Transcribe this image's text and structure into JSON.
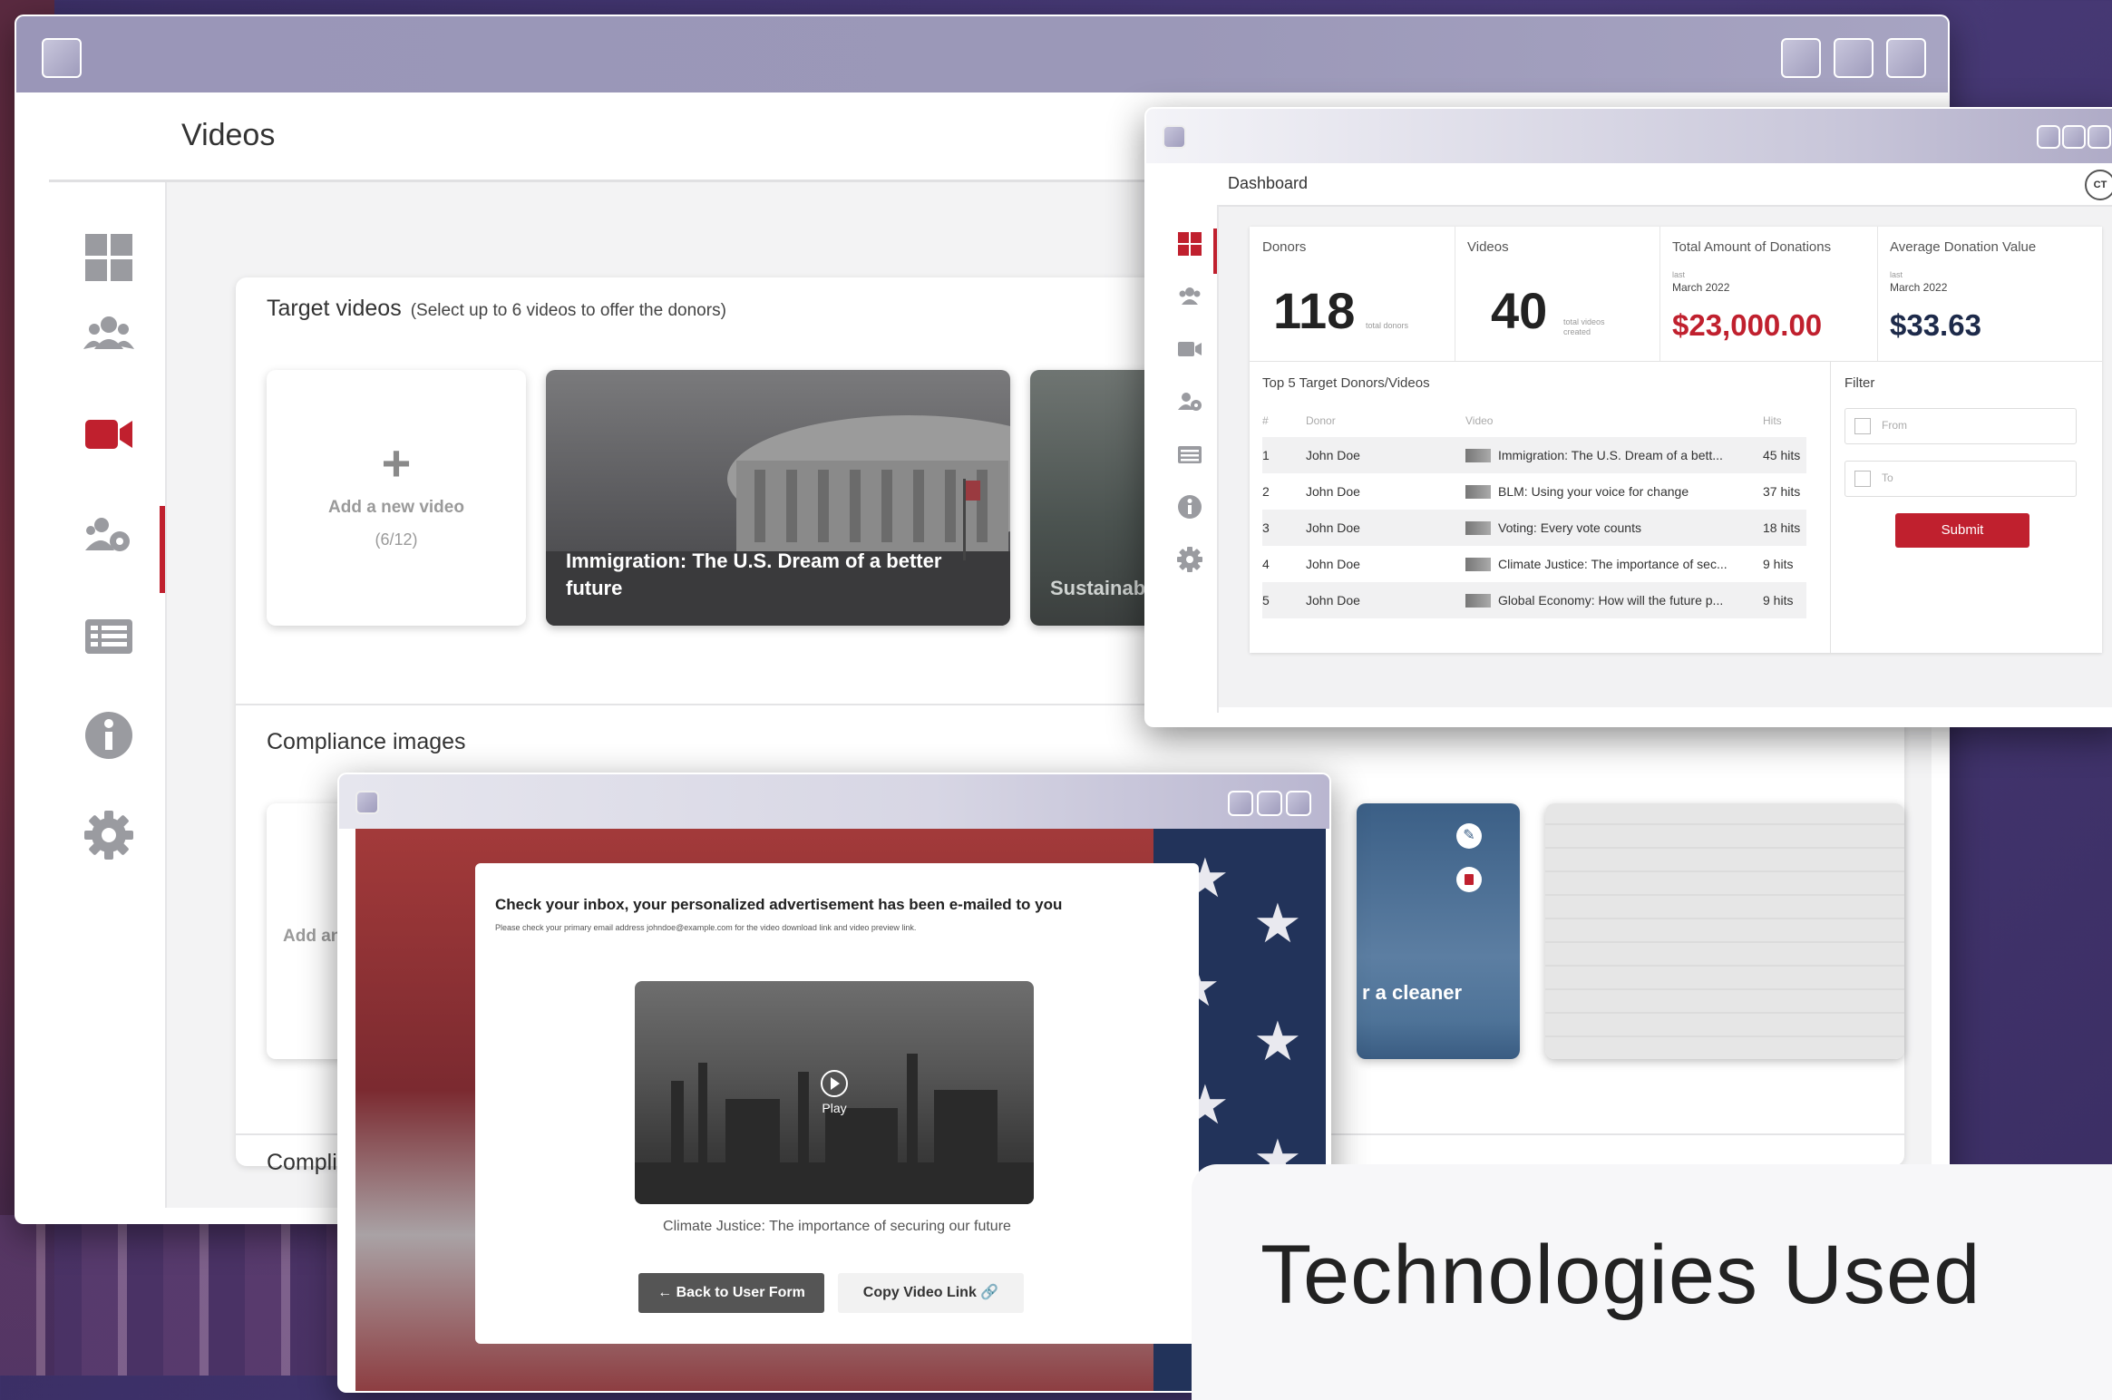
{
  "videos_page": {
    "title": "Videos",
    "target_videos": {
      "title": "Target videos",
      "subtitle": "(Select up to 6 videos to offer the donors)",
      "add_label": "Add a new video",
      "add_count": "(6/12)",
      "tiles": [
        {
          "caption": "Immigration: The U.S. Dream of a better future"
        },
        {
          "caption": "Sustainabil future"
        }
      ]
    },
    "compliance_images": {
      "title": "Compliance images",
      "add_label": "Add an i",
      "tile_caption": "r a cleaner"
    },
    "compliance_section_2": "Complian"
  },
  "dashboard": {
    "title": "Dashboard",
    "avatar": "CT",
    "stats": {
      "donors": {
        "label": "Donors",
        "value": "118",
        "note": "total donors"
      },
      "videos": {
        "label": "Videos",
        "value": "40",
        "note": "total videos created"
      },
      "total_donations": {
        "label": "Total Amount of Donations",
        "period_label": "last",
        "period": "March 2022",
        "value": "$23,000.00"
      },
      "avg_donation": {
        "label": "Average Donation Value",
        "period_label": "last",
        "period": "March 2022",
        "value": "$33.63"
      }
    },
    "top5": {
      "title": "Top 5 Target Donors/Videos",
      "headers": [
        "#",
        "Donor",
        "Video",
        "Hits"
      ],
      "rows": [
        {
          "n": "1",
          "donor": "John Doe",
          "video": "Immigration: The U.S. Dream of a bett...",
          "hits": "45 hits"
        },
        {
          "n": "2",
          "donor": "John Doe",
          "video": "BLM: Using your voice for change",
          "hits": "37 hits"
        },
        {
          "n": "3",
          "donor": "John Doe",
          "video": "Voting: Every vote counts",
          "hits": "18 hits"
        },
        {
          "n": "4",
          "donor": "John Doe",
          "video": "Climate Justice: The importance of sec...",
          "hits": "9 hits"
        },
        {
          "n": "5",
          "donor": "John Doe",
          "video": "Global Economy: How will the future p...",
          "hits": "9 hits"
        }
      ]
    },
    "filter": {
      "title": "Filter",
      "from_placeholder": "From",
      "to_placeholder": "To",
      "submit": "Submit"
    }
  },
  "email_modal": {
    "title": "Check your inbox, your personalized advertisement has been e-mailed to you",
    "subtitle": "Please check your primary email address johndoe@example.com for the video download link and video preview link.",
    "play": "Play",
    "video_caption": "Climate Justice: The importance of securing our future",
    "back_button": "Back to User Form",
    "copy_button": "Copy Video Link"
  },
  "technologies": {
    "title": "Technologies Used"
  },
  "colors": {
    "accent_red": "#c0202e",
    "navy": "#1d2a4a",
    "background": "#3b2f66"
  }
}
